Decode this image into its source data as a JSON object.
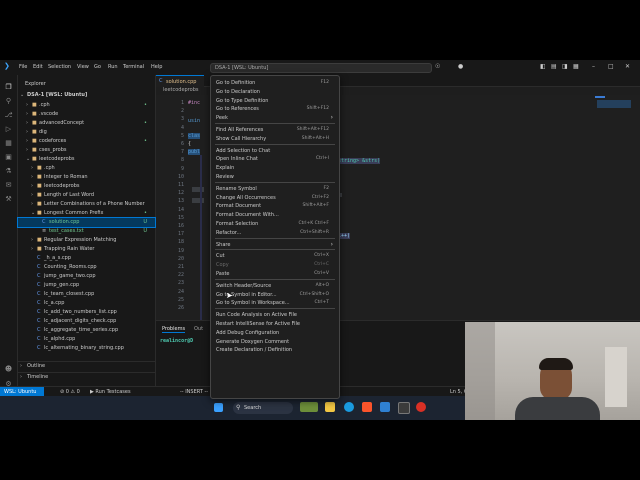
{
  "titlebar": {
    "menu": [
      "File",
      "Edit",
      "Selection",
      "View",
      "Go",
      "Run",
      "Terminal",
      "Help"
    ],
    "search_text": "DSA-1 [WSL: Ubuntu]",
    "controls": [
      "–",
      "□",
      "✕"
    ]
  },
  "sidebar": {
    "title": "Explorer",
    "root": "DSA-1 [WSL: Ubuntu]",
    "items": [
      {
        "label": ".cph",
        "badge": "•"
      },
      {
        "label": ".vscode",
        "badge": ""
      },
      {
        "label": "advancedConcept",
        "badge": "•"
      },
      {
        "label": "dig",
        "badge": ""
      },
      {
        "label": "codeforces",
        "badge": "•"
      },
      {
        "label": "cses_probs",
        "badge": ""
      },
      {
        "label": "leetcodeprobs",
        "badge": ""
      },
      {
        "label": ".cph",
        "badge": ""
      },
      {
        "label": "Integer to Roman",
        "badge": ""
      },
      {
        "label": "leetcodeprobs",
        "badge": ""
      },
      {
        "label": "Length of Last Word",
        "badge": ""
      },
      {
        "label": "Letter Combinations of a Phone Number",
        "badge": ""
      },
      {
        "label": "Longest Common Prefix",
        "badge": "•"
      },
      {
        "label": "solution.cpp",
        "badge": "U"
      },
      {
        "label": "test_cases.txt",
        "badge": "U"
      },
      {
        "label": "Regular Expression Matching",
        "badge": ""
      },
      {
        "label": "Trapping Rain Water",
        "badge": ""
      },
      {
        "label": "_h_a_s.cpp",
        "badge": ""
      },
      {
        "label": "Counting_Rooms.cpp",
        "badge": ""
      },
      {
        "label": "jump_game_two.cpp",
        "badge": ""
      },
      {
        "label": "jump_gen.cpp",
        "badge": ""
      },
      {
        "label": "lc_team_closest.cpp",
        "badge": ""
      },
      {
        "label": "lc_a.cpp",
        "badge": ""
      },
      {
        "label": "lc_add_two_numbers_list.cpp",
        "badge": ""
      },
      {
        "label": "lc_adjacent_digits_check.cpp",
        "badge": ""
      },
      {
        "label": "lc_aggregate_time_series.cpp",
        "badge": ""
      },
      {
        "label": "lc_alphd.cpp",
        "badge": ""
      },
      {
        "label": "lc_alternating_binary_string.cpp",
        "badge": ""
      }
    ],
    "outline": "Outline",
    "timeline": "Timeline"
  },
  "tabs": {
    "active": "solution.cpp",
    "breadcrumb": "leetcodeprobs"
  },
  "editor": {
    "line_numbers": [
      "1",
      "2",
      "3",
      "4",
      "5",
      "6",
      "7",
      "8",
      "9",
      "10",
      "11",
      "12",
      "13",
      "14",
      "15",
      "16",
      "17",
      "18",
      "19",
      "20",
      "21",
      "22",
      "23",
      "24",
      "25",
      "26"
    ],
    "visible_fragments": [
      "#inc",
      "usin",
      "clas",
      "{",
      "publ",
      "string> &strs)",
      "i++)"
    ]
  },
  "panel": {
    "tab_problems": "Problems",
    "tab_output": "Out",
    "prompt": "realincor@D"
  },
  "statusbar": {
    "remote": "WSL: Ubuntu",
    "branch": "⊘ 0 ⚠ 0",
    "run": "▶ Run Testcases",
    "insert": "-- INSERT --",
    "position": "Ln 5, C"
  },
  "taskbar": {
    "search_label": "Search"
  },
  "context_menu": {
    "items": [
      {
        "label": "Go to Definition",
        "key": "F12"
      },
      {
        "label": "Go to Declaration",
        "key": ""
      },
      {
        "label": "Go to Type Definition",
        "key": ""
      },
      {
        "label": "Go to References",
        "key": "Shift+F12"
      },
      {
        "label": "Peek",
        "key": "",
        "submenu": true
      },
      {
        "sep": true
      },
      {
        "label": "Find All References",
        "key": "Shift+Alt+F12"
      },
      {
        "label": "Show Call Hierarchy",
        "key": "Shift+Alt+H"
      },
      {
        "sep": true
      },
      {
        "label": "Add Selection to Chat",
        "key": ""
      },
      {
        "label": "Open Inline Chat",
        "key": "Ctrl+I"
      },
      {
        "label": "Explain",
        "key": ""
      },
      {
        "label": "Review",
        "key": ""
      },
      {
        "sep": true
      },
      {
        "label": "Rename Symbol",
        "key": "F2"
      },
      {
        "label": "Change All Occurrences",
        "key": "Ctrl+F2"
      },
      {
        "label": "Format Document",
        "key": "Shift+Alt+F"
      },
      {
        "label": "Format Document With...",
        "key": ""
      },
      {
        "label": "Format Selection",
        "key": "Ctrl+K Ctrl+F"
      },
      {
        "label": "Refactor...",
        "key": "Ctrl+Shift+R"
      },
      {
        "sep": true
      },
      {
        "label": "Share",
        "key": "",
        "submenu": true
      },
      {
        "sep": true
      },
      {
        "label": "Cut",
        "key": "Ctrl+X"
      },
      {
        "label": "Copy",
        "key": "Ctrl+C",
        "disabled": true
      },
      {
        "label": "Paste",
        "key": "Ctrl+V"
      },
      {
        "sep": true
      },
      {
        "label": "Switch Header/Source",
        "key": "Alt+O"
      },
      {
        "label": "Go to Symbol in Editor...",
        "key": "Ctrl+Shift+O"
      },
      {
        "label": "Go to Symbol in Workspace...",
        "key": "Ctrl+T"
      },
      {
        "sep": true
      },
      {
        "label": "Run Code Analysis on Active File",
        "key": ""
      },
      {
        "label": "Restart IntelliSense for Active File",
        "key": ""
      },
      {
        "label": "Add Debug Configuration",
        "key": ""
      },
      {
        "label": "Generate Doxygen Comment",
        "key": ""
      },
      {
        "label": "Create Declaration / Definition",
        "key": ""
      }
    ]
  },
  "colors": {
    "accent": "#0078d4",
    "untracked": "#73c991",
    "modified": "#e2c08d",
    "keyword": "#569cd6",
    "string": "#ce9178"
  }
}
